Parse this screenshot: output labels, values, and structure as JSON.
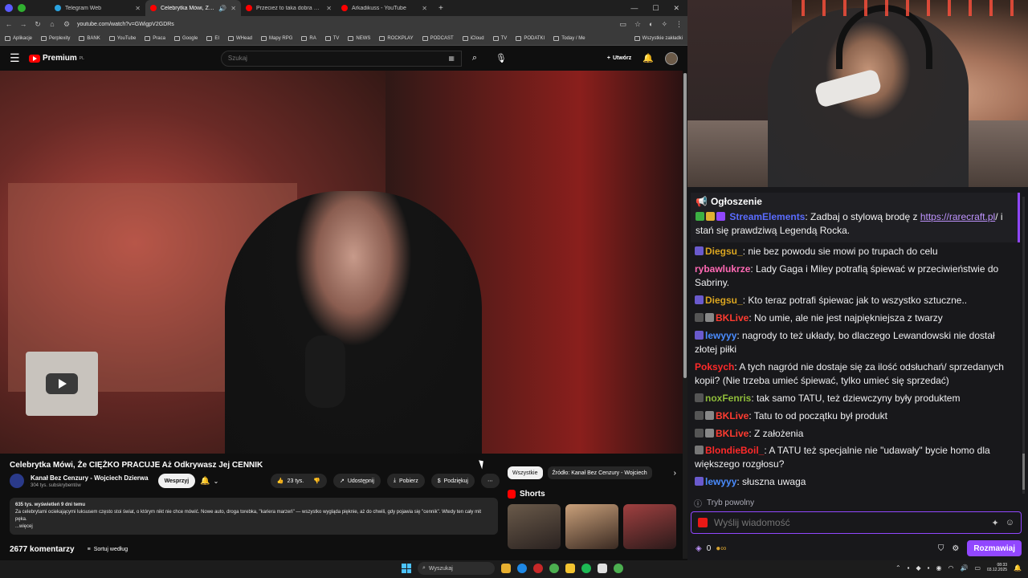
{
  "browser": {
    "tabs": [
      {
        "label": "Telegram Web",
        "color": "#2aa3e0",
        "active": false
      },
      {
        "label": "Celebrytka Mówi, Że CIĘŻK",
        "color": "#ff0000",
        "active": true
      },
      {
        "label": "Przecież to taka dobra gra była",
        "color": "#ff0000",
        "active": false
      },
      {
        "label": "Arkadikuss - YouTube",
        "color": "#ff0000",
        "active": false
      }
    ],
    "url": "youtube.com/watch?v=GWigpV2GDRs",
    "bookmarks": [
      "Aplikacje",
      "Perplexity",
      "BANK",
      "YouTube",
      "Praca",
      "Google",
      "EI",
      "WHead",
      "Mapy RPG",
      "RA",
      "TV",
      "NEWS",
      "ROCKPLAY",
      "PODCAST",
      "iCloud",
      "TV",
      "PODATKI",
      "Today / Me"
    ],
    "bookmarks_right": "Wszystkie zakładki"
  },
  "youtube": {
    "logo": "Premium",
    "logo_sup": "PL",
    "search_placeholder": "Szukaj",
    "create_label": "Utwórz",
    "video_title": "Celebrytka Mówi, Że CIĘŻKO PRACUJE Aż Odkrywasz Jej CENNIK",
    "channel_name": "Kanał Bez Cenzury - Wojciech Dzierwa",
    "channel_subs": "304 tys. subskrybentów",
    "support_label": "Wesprzyj",
    "likes": "23 tys.",
    "share_label": "Udostępnij",
    "download_label": "Pobierz",
    "thanks_label": "Podziękuj",
    "desc_stats": "635 tys. wyświetleń  9 dni temu",
    "desc_text": "Za celebrytami ociekającymi luksusem często stoi świat, o którym nikt nie chce mówić. Nowe auto, droga torebka, \"kariera marzeń\" — wszystko wygląda pięknie, aż do chwili, gdy pojawia się \"cennik\". Wtedy ten cały mit pęka.",
    "desc_more": "...więcej",
    "comments_count": "2677 komentarzy",
    "sort_label": "Sortuj według",
    "chips": [
      "Wszystkie",
      "Źródło: Kanał Bez Cenzury - Wojciech"
    ],
    "shorts_label": "Shorts"
  },
  "chat": {
    "announcement_title": "Ogłoszenie",
    "messages": [
      {
        "user": "StreamElements",
        "color": "#5a6cff",
        "pre": "",
        "text": ": Zadbaj o stylową brodę z ",
        "link": "https://rarecraft.pl",
        "post": "/ i stań się prawdziwą Legendą Rocka."
      },
      {
        "user": "Diegsu_",
        "color": "#daa520",
        "text": ": nie bez powodu sie mowi po trupach do celu"
      },
      {
        "user": "rybawlukrze",
        "color": "#ff69b4",
        "text": ": Lady Gaga i Miley potrafią śpiewać w przeciwieństwie do Sabriny."
      },
      {
        "user": "Diegsu_",
        "color": "#daa520",
        "text": ": Kto teraz potrafi śpiewac jak to wszystko sztuczne.."
      },
      {
        "user": "BKLive",
        "color": "#ff3b30",
        "text": ": No umie, ale nie jest najpiękniejsza z twarzy"
      },
      {
        "user": "lewyyy",
        "color": "#4a8cff",
        "text": ": nagrody to też układy, bo dlaczego Lewandowski nie dostał złotej piłki"
      },
      {
        "user": "Poksych",
        "color": "#ff2a2a",
        "text": ": A tych nagród nie dostaje się za ilość odsłuchań/ sprzedanych kopii? (Nie trzeba umieć śpiewać, tylko umieć się sprzedać)"
      },
      {
        "user": "noxFenris",
        "color": "#8fbc3a",
        "text": ": tak samo TATU, też dziewczyny były produktem"
      },
      {
        "user": "BKLive",
        "color": "#ff3b30",
        "text": ": Tatu to od początku był produkt"
      },
      {
        "user": "BKLive",
        "color": "#ff3b30",
        "text": ": Z założenia"
      },
      {
        "user": "BlondieBoil_",
        "color": "#ff2a2a",
        "text": ": A TATU też specjalnie nie \"udawały\" bycie homo dla większego rozgłosu?"
      },
      {
        "user": "lewyyy",
        "color": "#4a8cff",
        "text": ": słuszna uwaga"
      }
    ],
    "slow_mode": "Tryb powolny",
    "input_placeholder": "Wyślij wiadomość",
    "points": "0",
    "chat_button": "Rozmawiaj",
    "accent": "#9147ff"
  },
  "taskbar": {
    "search_placeholder": "Wyszukaj",
    "time": "08:33",
    "date": "03.12.2025"
  }
}
